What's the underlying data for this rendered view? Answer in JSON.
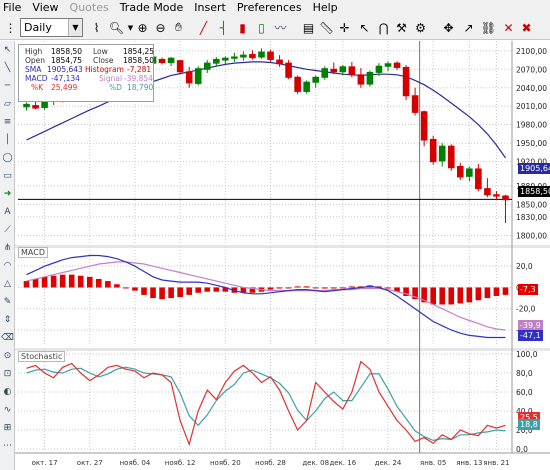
{
  "menu": [
    "File",
    "View",
    "Quotes",
    "Trade Mode",
    "Insert",
    "Preferences",
    "Help"
  ],
  "menu_disabled": [
    "Quotes"
  ],
  "toolbar": {
    "period": "Daily",
    "icons": [
      "pointer-icon",
      "zoom-icon",
      "trendline-icon",
      "zoom-in-icon",
      "zoom-out-icon",
      "chart-type-icon",
      "indicators-icon",
      "bar-style-icon",
      "candle-style-icon",
      "line-style-icon",
      "ruler-icon",
      "crosshair-icon",
      "cursor-icon",
      "magnet-icon",
      "tools-icon",
      "settings-icon",
      "arrow-icon",
      "close-icon",
      "pin-icon",
      "minimize-icon"
    ]
  },
  "info": {
    "high_label": "High",
    "high": "1858,50",
    "low_label": "Low",
    "low": "1854,25",
    "open_label": "Open",
    "open": "1854,75",
    "close_label": "Close",
    "close": "1858,50",
    "sma_label": "SMA",
    "sma": "1905,643",
    "histogram_label": "Histogram",
    "histogram": "-7,281",
    "macd_label": "MACD",
    "macd": "-47,134",
    "signal_label": "Signal",
    "signal": "-39,854",
    "k_label": "%K",
    "k": "25,499",
    "d_label": "%D",
    "d": "18,790"
  },
  "panes": {
    "macd_label": "MACD",
    "stoch_label": "Stochastic"
  },
  "price_axis": [
    "2100,00",
    "2070,00",
    "2040,00",
    "2010,00",
    "1980,00",
    "1950,00",
    "1920,00",
    "1880,00",
    "1850,00",
    "1830,00",
    "1800,00"
  ],
  "price_tags": {
    "sma": "1905,64",
    "last": "1858,50"
  },
  "macd_axis": [
    "20,0",
    "0,0",
    "-20,0",
    "-40,0"
  ],
  "macd_tags": {
    "hist": "-7,3",
    "signal": "-39,9",
    "macd": "-47,1"
  },
  "stoch_axis": [
    "100,0",
    "80,0",
    "60,0",
    "40,0",
    "20,0",
    "0,0"
  ],
  "stoch_tags": {
    "k": "25,5",
    "d": "18,8"
  },
  "x_axis": [
    "окт. 17",
    "окт. 27",
    "нояб. 04",
    "нояб. 12",
    "нояб. 20",
    "нояб. 28",
    "дек. 08",
    "дек. 16",
    "дек. 24",
    "янв. 05",
    "янв. 13",
    "янв. 21"
  ],
  "colors": {
    "up": "#008000",
    "down": "#d40000",
    "sma": "#2a2aa0",
    "macd": "#3030c8",
    "signal": "#c080c8",
    "hist": "#e00000",
    "k": "#e03030",
    "d": "#40a0a8",
    "grid": "#c8c8c8",
    "last_line": "#000000"
  },
  "chart_data": {
    "type": "candlestick",
    "candles": [
      [
        2009,
        2016,
        2003,
        2013
      ],
      [
        2011,
        2019,
        2005,
        2007
      ],
      [
        2008,
        2024,
        2004,
        2020
      ],
      [
        2018,
        2030,
        2012,
        2026
      ],
      [
        2025,
        2033,
        2016,
        2021
      ],
      [
        2023,
        2035,
        2018,
        2030
      ],
      [
        2029,
        2036,
        2023,
        2032
      ],
      [
        2031,
        2042,
        2026,
        2039
      ],
      [
        2040,
        2048,
        2030,
        2035
      ],
      [
        2037,
        2060,
        2034,
        2057
      ],
      [
        2057,
        2075,
        2052,
        2069
      ],
      [
        2069,
        2080,
        2060,
        2075
      ],
      [
        2075,
        2088,
        2070,
        2084
      ],
      [
        2082,
        2092,
        2074,
        2080
      ],
      [
        2080,
        2095,
        2076,
        2090
      ],
      [
        2086,
        2089,
        2078,
        2081
      ],
      [
        2081,
        2090,
        2075,
        2088
      ],
      [
        2084,
        2085,
        2062,
        2066
      ],
      [
        2066,
        2074,
        2040,
        2048
      ],
      [
        2047,
        2075,
        2044,
        2071
      ],
      [
        2070,
        2085,
        2064,
        2080
      ],
      [
        2080,
        2090,
        2074,
        2086
      ],
      [
        2085,
        2091,
        2078,
        2088
      ],
      [
        2088,
        2097,
        2082,
        2090
      ],
      [
        2090,
        2099,
        2084,
        2093
      ],
      [
        2094,
        2101,
        2086,
        2089
      ],
      [
        2090,
        2104,
        2087,
        2098
      ],
      [
        2098,
        2102,
        2082,
        2086
      ],
      [
        2085,
        2093,
        2074,
        2079
      ],
      [
        2080,
        2085,
        2054,
        2057
      ],
      [
        2057,
        2060,
        2030,
        2034
      ],
      [
        2034,
        2052,
        2030,
        2049
      ],
      [
        2049,
        2060,
        2040,
        2057
      ],
      [
        2057,
        2075,
        2053,
        2071
      ],
      [
        2070,
        2081,
        2062,
        2066
      ],
      [
        2066,
        2077,
        2060,
        2074
      ],
      [
        2074,
        2082,
        2057,
        2061
      ],
      [
        2061,
        2072,
        2040,
        2046
      ],
      [
        2046,
        2068,
        2042,
        2065
      ],
      [
        2065,
        2080,
        2059,
        2075
      ],
      [
        2075,
        2083,
        2067,
        2079
      ],
      [
        2080,
        2083,
        2069,
        2073
      ],
      [
        2073,
        2077,
        2020,
        2027
      ],
      [
        2027,
        2040,
        1995,
        2000
      ],
      [
        2001,
        2003,
        1945,
        1955
      ],
      [
        1956,
        1962,
        1915,
        1920
      ],
      [
        1921,
        1950,
        1912,
        1945
      ],
      [
        1945,
        1948,
        1905,
        1910
      ],
      [
        1912,
        1918,
        1890,
        1895
      ],
      [
        1896,
        1912,
        1888,
        1908
      ],
      [
        1908,
        1916,
        1872,
        1876
      ],
      [
        1876,
        1893,
        1862,
        1866
      ],
      [
        1866,
        1872,
        1858,
        1864
      ],
      [
        1864,
        1866,
        1820,
        1858
      ]
    ],
    "sma": [
      1955,
      1962,
      1969,
      1976,
      1983,
      1990,
      1997,
      2004,
      2010,
      2017,
      2024,
      2031,
      2038,
      2044,
      2050,
      2055,
      2060,
      2063,
      2066,
      2069,
      2072,
      2075,
      2078,
      2080,
      2081,
      2082,
      2082,
      2081,
      2079,
      2076,
      2073,
      2070,
      2068,
      2066,
      2064,
      2062,
      2061,
      2060,
      2061,
      2062,
      2062,
      2061,
      2058,
      2052,
      2045,
      2036,
      2026,
      2015,
      2004,
      1993,
      1980,
      1965,
      1947,
      1926
    ],
    "macd": [
      12,
      16,
      20,
      23,
      26,
      28,
      29,
      30,
      30,
      29,
      27,
      24,
      20,
      15,
      10,
      7,
      6,
      5,
      5,
      5,
      4,
      2,
      0,
      -3,
      -5,
      -6,
      -6,
      -5,
      -4,
      -3,
      -2,
      -2,
      -3,
      -4,
      -3,
      -2,
      -1,
      0,
      1,
      0,
      -3,
      -8,
      -14,
      -20,
      -26,
      -32,
      -36,
      -40,
      -43,
      -45,
      -46,
      -47,
      -47,
      -47
    ],
    "signal": [
      6,
      8,
      10,
      12,
      14,
      16,
      18,
      20,
      22,
      23,
      24,
      24,
      23,
      22,
      20,
      18,
      16,
      14,
      12,
      10,
      8,
      6,
      4,
      2,
      0,
      -1,
      -2,
      -3,
      -3,
      -3,
      -3,
      -3,
      -3,
      -3,
      -2,
      -2,
      -2,
      -1,
      -1,
      -1,
      -2,
      -4,
      -6,
      -9,
      -12,
      -16,
      -20,
      -24,
      -28,
      -31,
      -34,
      -37,
      -39,
      -40
    ],
    "stoch_k": [
      85,
      88,
      80,
      75,
      86,
      90,
      80,
      72,
      78,
      86,
      88,
      84,
      82,
      75,
      80,
      78,
      70,
      30,
      5,
      40,
      62,
      52,
      70,
      82,
      88,
      80,
      70,
      76,
      62,
      40,
      20,
      30,
      70,
      60,
      50,
      42,
      60,
      92,
      84,
      60,
      45,
      30,
      20,
      8,
      12,
      6,
      15,
      10,
      20,
      16,
      14,
      25,
      22,
      25
    ],
    "stoch_d": [
      80,
      83,
      84,
      81,
      80,
      84,
      85,
      80,
      76,
      79,
      84,
      86,
      84,
      80,
      79,
      78,
      76,
      59,
      35,
      25,
      36,
      51,
      61,
      68,
      80,
      83,
      79,
      75,
      69,
      59,
      41,
      30,
      40,
      53,
      60,
      51,
      51,
      65,
      79,
      79,
      63,
      45,
      32,
      19,
      13,
      9,
      11,
      10,
      15,
      15,
      17,
      18,
      20,
      19
    ]
  }
}
